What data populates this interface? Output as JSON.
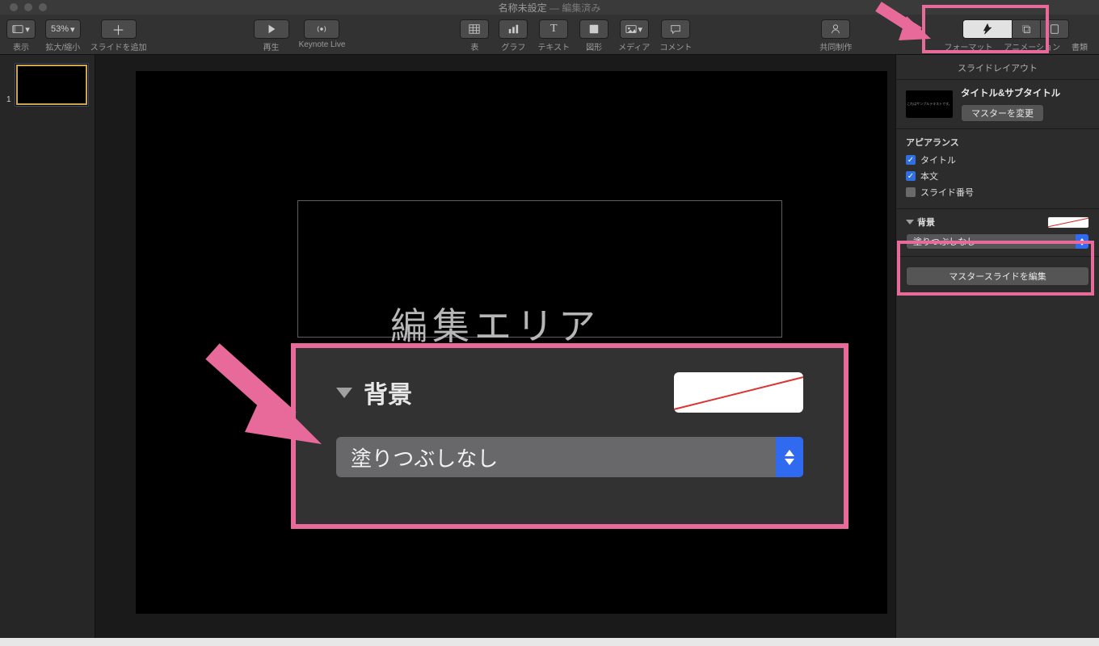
{
  "window": {
    "title": "名称未設定",
    "subtitle": "— 編集済み"
  },
  "toolbar": {
    "view_label": "表示",
    "zoom_value": "53%",
    "zoom_label": "拡大/縮小",
    "add_slide_label": "スライドを追加",
    "play_label": "再生",
    "keynote_live_label": "Keynote Live",
    "table_label": "表",
    "chart_label": "グラフ",
    "text_label": "テキスト",
    "shape_label": "図形",
    "media_label": "メディア",
    "comment_label": "コメント",
    "collaborate_label": "共同制作",
    "format_label": "フォーマット",
    "animate_label": "アニメーション",
    "document_label": "書類"
  },
  "navigator": {
    "slides": [
      {
        "number": "1"
      }
    ]
  },
  "canvas": {
    "overlay_text": "編集エリア"
  },
  "inspector": {
    "header": "スライドレイアウト",
    "master": {
      "title": "タイトル&サブタイトル",
      "change_btn": "マスターを変更",
      "thumb_text": "これはサンプルテキストです。"
    },
    "appearance": {
      "section_title": "アピアランス",
      "title_chk": "タイトル",
      "body_chk": "本文",
      "slidenum_chk": "スライド番号"
    },
    "background": {
      "label": "背景",
      "fill_value": "塗りつぶしなし"
    },
    "edit_master_btn": "マスタースライドを編集"
  },
  "callout": {
    "label": "背景",
    "fill_value": "塗りつぶしなし"
  }
}
